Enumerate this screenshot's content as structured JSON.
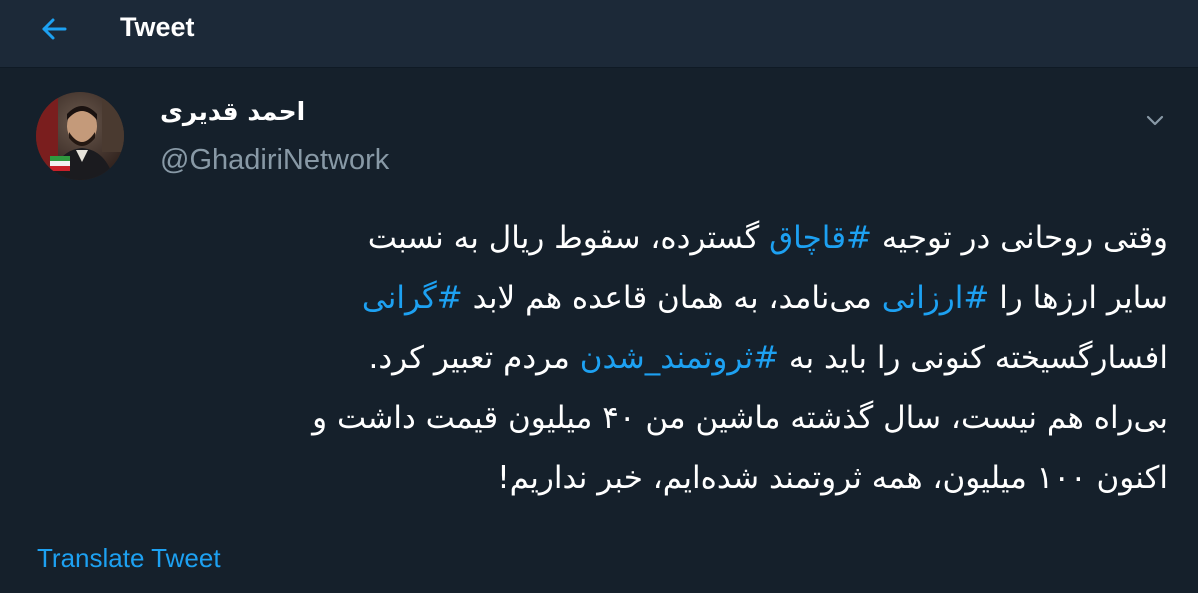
{
  "header": {
    "title": "Tweet",
    "back_icon": "arrow-left-icon",
    "accent_color": "#1da1f2"
  },
  "author": {
    "display_name": "احمد قدیری",
    "handle": "@GhadiriNetwork",
    "avatar_icon": "avatar-photo"
  },
  "tweet": {
    "lines": [
      {
        "segments": [
          {
            "text": "وقتی روحانی در توجیه ",
            "hashtag": false
          },
          {
            "text": "#قاچاق",
            "hashtag": true
          },
          {
            "text": " گسترده، سقوط ریال به نسبت",
            "hashtag": false
          }
        ]
      },
      {
        "segments": [
          {
            "text": "سایر ارزها را ",
            "hashtag": false
          },
          {
            "text": "#ارزانی",
            "hashtag": true
          },
          {
            "text": " می‌نامد، به همان قاعده هم لابد ",
            "hashtag": false
          },
          {
            "text": "#گرانی",
            "hashtag": true
          }
        ]
      },
      {
        "segments": [
          {
            "text": "افسارگسیخته کنونی را باید به ",
            "hashtag": false
          },
          {
            "text": "#ثروتمند_شدن",
            "hashtag": true
          },
          {
            "text": " مردم تعبیر کرد.",
            "hashtag": false
          }
        ]
      },
      {
        "segments": [
          {
            "text": "بی‌راه هم نیست، سال گذشته ماشین من ۴۰ میلیون قیمت داشت و",
            "hashtag": false
          }
        ]
      },
      {
        "segments": [
          {
            "text": "اکنون ۱۰۰ میلیون، همه ثروتمند شده‌ایم، خبر نداریم!",
            "hashtag": false
          }
        ]
      }
    ],
    "translate_label": "Translate Tweet"
  },
  "colors": {
    "background": "#15202b",
    "header_background": "#1c2938",
    "secondary_text": "#8899a6",
    "link": "#1da1f2"
  }
}
